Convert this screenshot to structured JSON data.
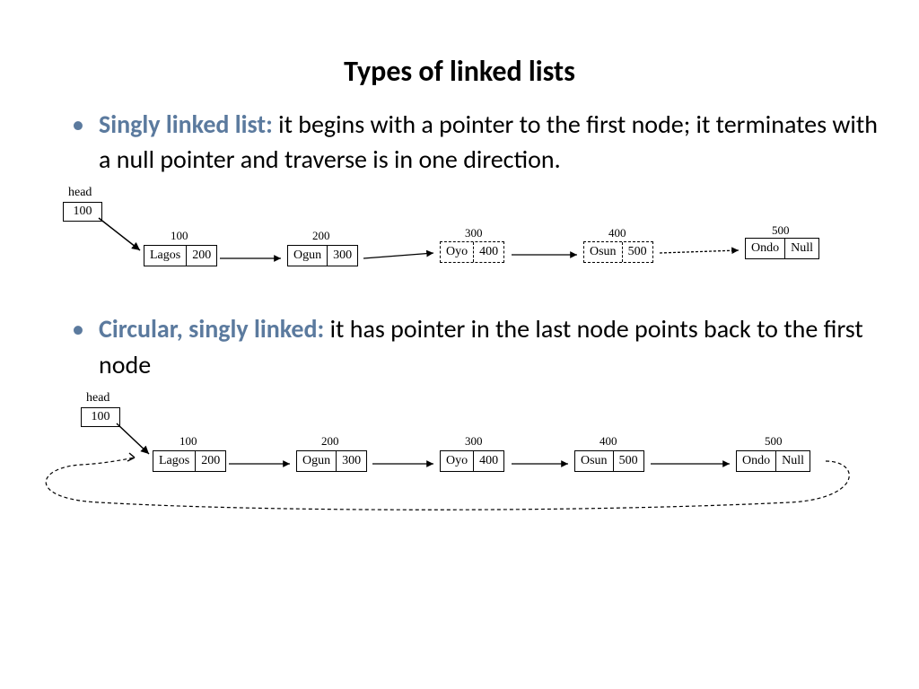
{
  "title": "Types of linked lists",
  "bullet1": {
    "label": "Singly linked list: ",
    "text": "it begins with a pointer to the first node; it terminates with a null pointer and traverse is in one direction."
  },
  "bullet2": {
    "label": "Circular, singly linked: ",
    "text": "it has pointer in the last node points back to the first node"
  },
  "diagram1": {
    "head_label": "head",
    "head_value": "100",
    "nodes": [
      {
        "addr": "100",
        "data": "Lagos",
        "next": "200"
      },
      {
        "addr": "200",
        "data": "Ogun",
        "next": "300"
      },
      {
        "addr": "300",
        "data": "Oyo",
        "next": "400"
      },
      {
        "addr": "400",
        "data": "Osun",
        "next": "500"
      },
      {
        "addr": "500",
        "data": "Ondo",
        "next": "Null"
      }
    ]
  },
  "diagram2": {
    "head_label": "head",
    "head_value": "100",
    "nodes": [
      {
        "addr": "100",
        "data": "Lagos",
        "next": "200"
      },
      {
        "addr": "200",
        "data": "Ogun",
        "next": "300"
      },
      {
        "addr": "300",
        "data": "Oyo",
        "next": "400"
      },
      {
        "addr": "400",
        "data": "Osun",
        "next": "500"
      },
      {
        "addr": "500",
        "data": "Ondo",
        "next": "Null"
      }
    ]
  }
}
